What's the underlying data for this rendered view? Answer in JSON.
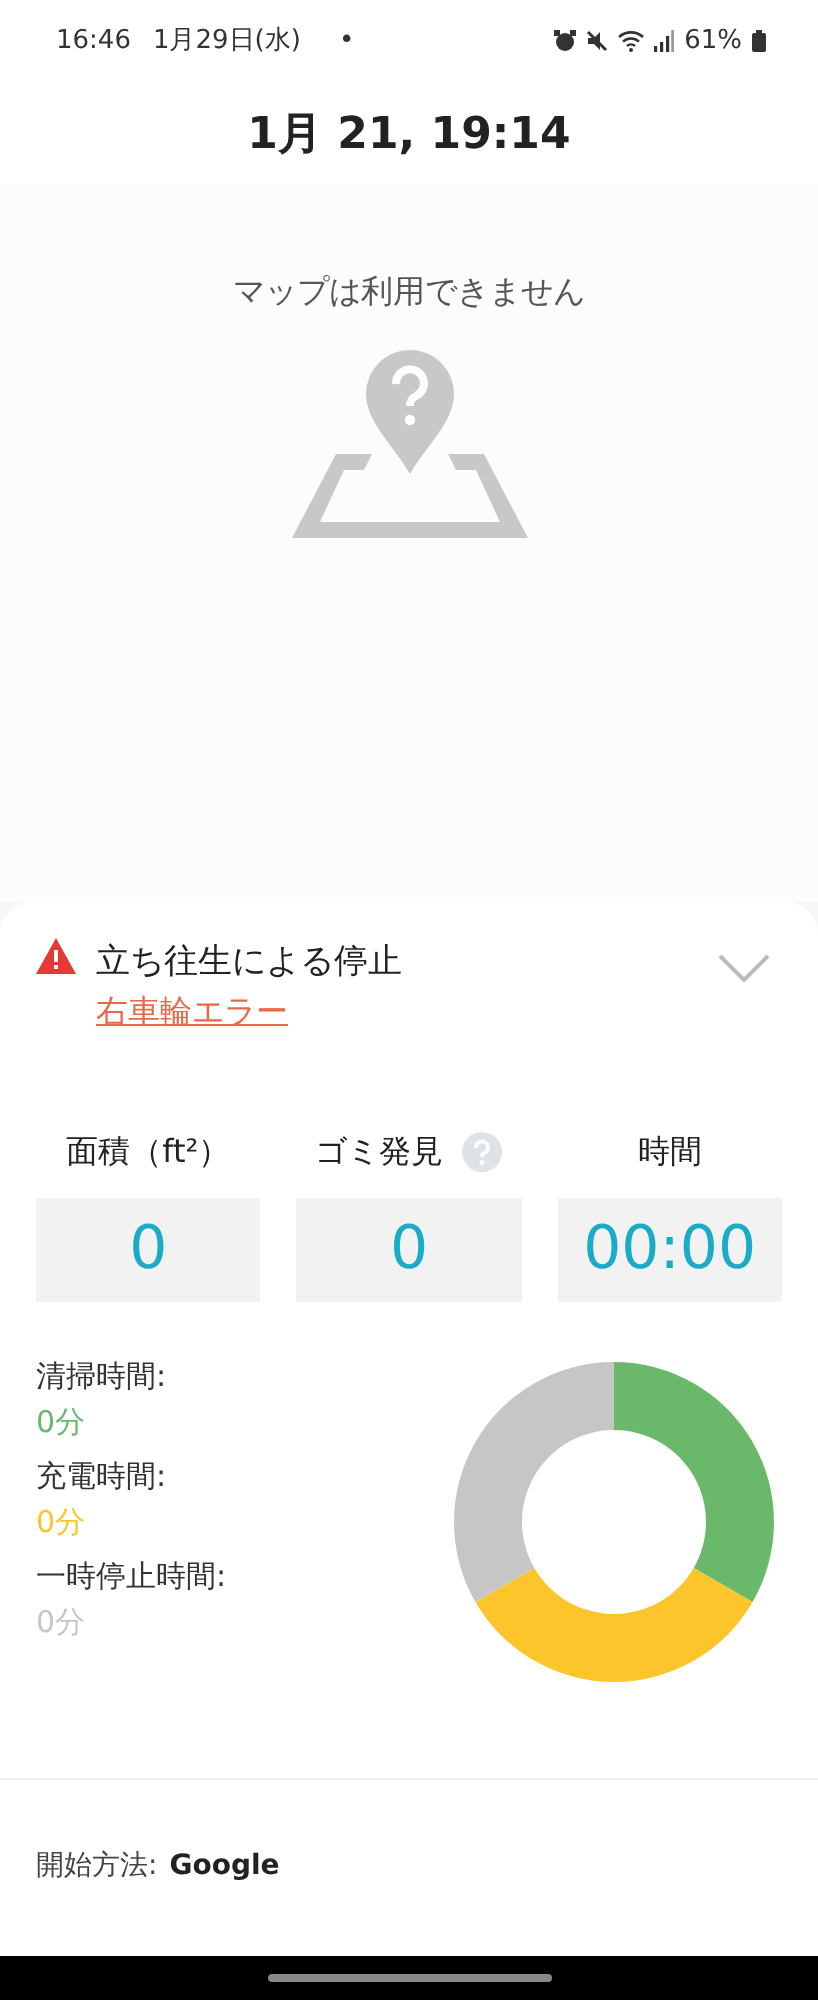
{
  "status_bar": {
    "time": "16:46",
    "date": "1月29日(水)",
    "dot": "•",
    "battery": "61%"
  },
  "title": "1月 21, 19:14",
  "map": {
    "message": "マップは利用できません"
  },
  "alert": {
    "title": "立ち往生による停止",
    "link": "右車輪エラー",
    "expanded": false
  },
  "stats": [
    {
      "label": "面積（ft²）",
      "value": "0",
      "help": false
    },
    {
      "label": "ゴミ発見",
      "value": "0",
      "help": true
    },
    {
      "label": "時間",
      "value": "00:00",
      "help": false
    }
  ],
  "legend": [
    {
      "label": "清掃時間:",
      "value": "0分",
      "color": "#6ab96a"
    },
    {
      "label": "充電時間:",
      "value": "0分",
      "color": "#fcc52c"
    },
    {
      "label": "一時停止時間:",
      "value": "0分",
      "color": "#c6c6c6"
    }
  ],
  "start_method": {
    "label": "開始方法:",
    "value": "Google"
  }
}
